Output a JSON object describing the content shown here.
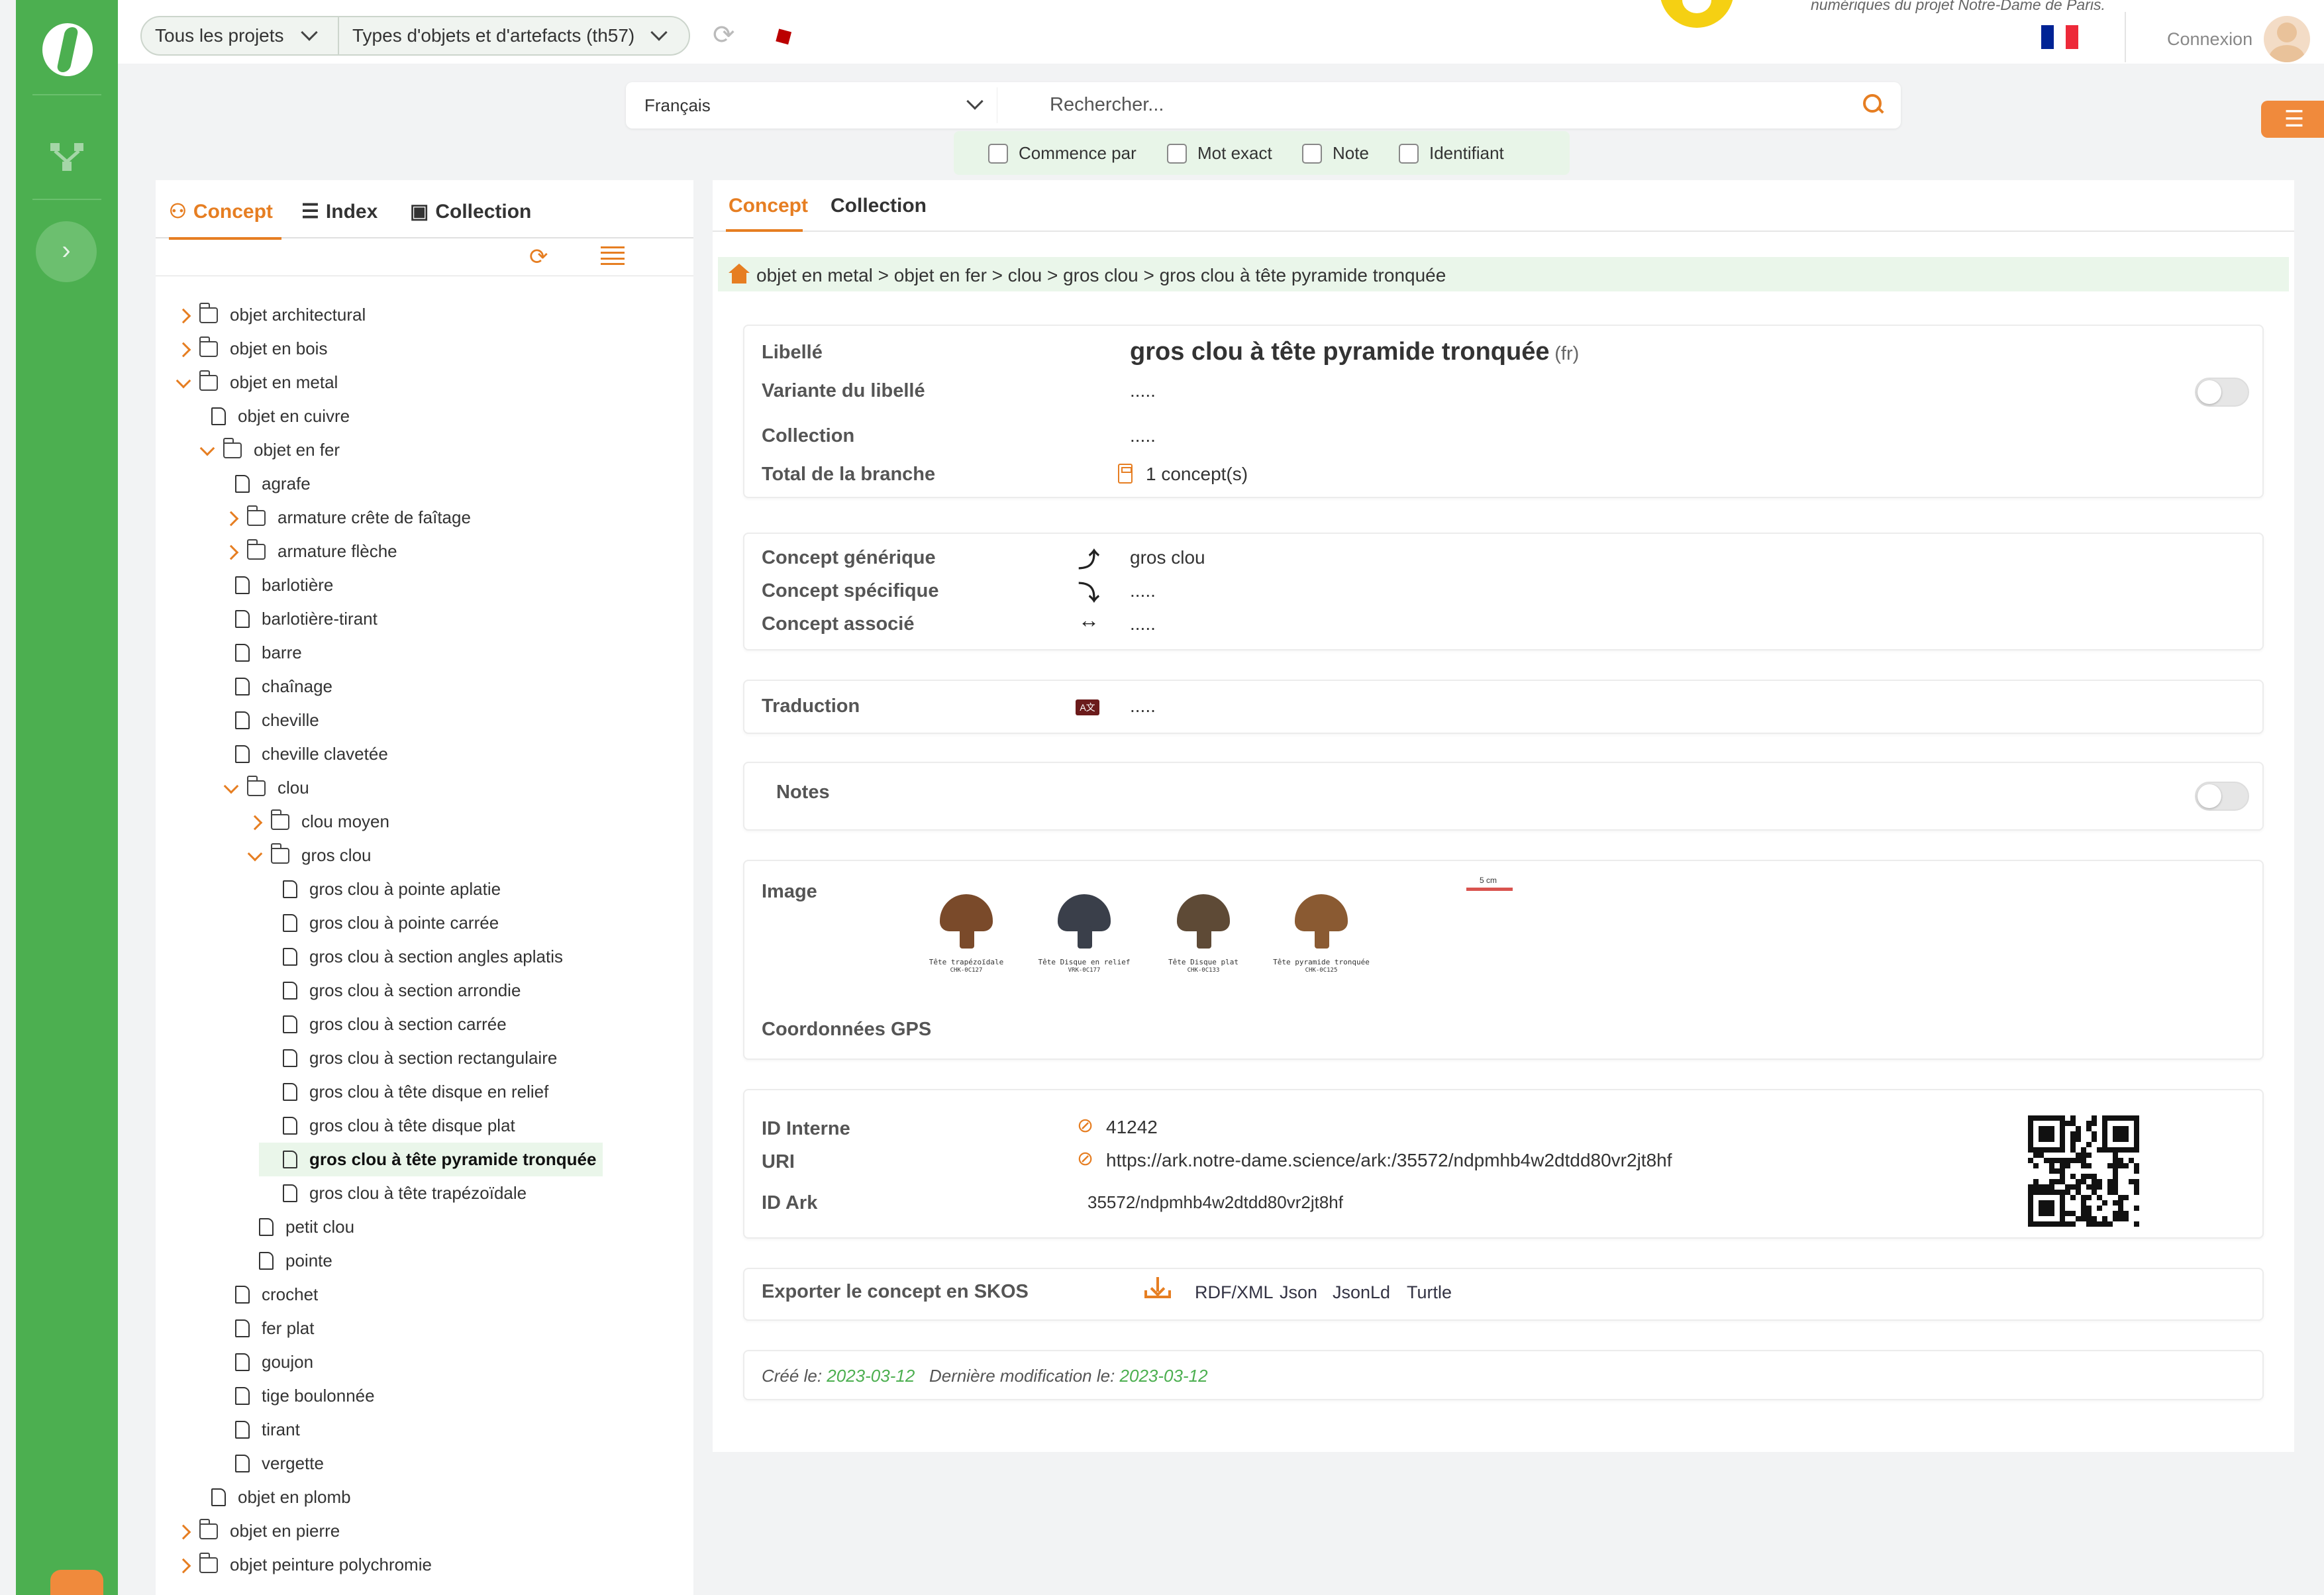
{
  "topbar": {
    "project_select": "Tous les projets",
    "thesaurus_select": "Types d'objets et d'artefacts (th57)",
    "tagline": "numériques du projet Notre-Dame de Paris.",
    "login": "Connexion",
    "flag_colors": [
      "#002395",
      "#ffffff",
      "#ed2939"
    ]
  },
  "search": {
    "language": "Français",
    "placeholder": "Rechercher...",
    "filters": [
      "Commence par",
      "Mot exact",
      "Note",
      "Identifiant"
    ]
  },
  "left_panel": {
    "tabs": [
      "Concept",
      "Index",
      "Collection"
    ],
    "tree": [
      {
        "label": "objet architectural",
        "depth": 0,
        "type": "folder",
        "state": "closed"
      },
      {
        "label": "objet en bois",
        "depth": 0,
        "type": "folder",
        "state": "closed"
      },
      {
        "label": "objet en metal",
        "depth": 0,
        "type": "folder",
        "state": "open"
      },
      {
        "label": "objet en cuivre",
        "depth": 1,
        "type": "file"
      },
      {
        "label": "objet en fer",
        "depth": 1,
        "type": "folder",
        "state": "open"
      },
      {
        "label": "agrafe",
        "depth": 2,
        "type": "file"
      },
      {
        "label": "armature crête de faîtage",
        "depth": 2,
        "type": "folder",
        "state": "closed"
      },
      {
        "label": "armature flèche",
        "depth": 2,
        "type": "folder",
        "state": "closed"
      },
      {
        "label": "barlotière",
        "depth": 2,
        "type": "file"
      },
      {
        "label": "barlotière-tirant",
        "depth": 2,
        "type": "file"
      },
      {
        "label": "barre",
        "depth": 2,
        "type": "file"
      },
      {
        "label": "chaînage",
        "depth": 2,
        "type": "file"
      },
      {
        "label": "cheville",
        "depth": 2,
        "type": "file"
      },
      {
        "label": "cheville clavetée",
        "depth": 2,
        "type": "file"
      },
      {
        "label": "clou",
        "depth": 2,
        "type": "folder",
        "state": "open"
      },
      {
        "label": "clou moyen",
        "depth": 3,
        "type": "folder",
        "state": "closed"
      },
      {
        "label": "gros clou",
        "depth": 3,
        "type": "folder",
        "state": "open"
      },
      {
        "label": "gros clou à pointe aplatie",
        "depth": 4,
        "type": "file"
      },
      {
        "label": "gros clou à pointe carrée",
        "depth": 4,
        "type": "file"
      },
      {
        "label": "gros clou à section angles aplatis",
        "depth": 4,
        "type": "file"
      },
      {
        "label": "gros clou à section arrondie",
        "depth": 4,
        "type": "file"
      },
      {
        "label": "gros clou à section carrée",
        "depth": 4,
        "type": "file"
      },
      {
        "label": "gros clou à section rectangulaire",
        "depth": 4,
        "type": "file"
      },
      {
        "label": "gros clou à tête disque en relief",
        "depth": 4,
        "type": "file"
      },
      {
        "label": "gros clou à tête disque plat",
        "depth": 4,
        "type": "file"
      },
      {
        "label": "gros clou à tête pyramide tronquée",
        "depth": 4,
        "type": "file",
        "selected": true
      },
      {
        "label": "gros clou à tête trapézoïdale",
        "depth": 4,
        "type": "file"
      },
      {
        "label": "petit clou",
        "depth": 3,
        "type": "file"
      },
      {
        "label": "pointe",
        "depth": 3,
        "type": "file"
      },
      {
        "label": "crochet",
        "depth": 2,
        "type": "file"
      },
      {
        "label": "fer plat",
        "depth": 2,
        "type": "file"
      },
      {
        "label": "goujon",
        "depth": 2,
        "type": "file"
      },
      {
        "label": "tige boulonnée",
        "depth": 2,
        "type": "file"
      },
      {
        "label": "tirant",
        "depth": 2,
        "type": "file"
      },
      {
        "label": "vergette",
        "depth": 2,
        "type": "file"
      },
      {
        "label": "objet en plomb",
        "depth": 1,
        "type": "file"
      },
      {
        "label": "objet en pierre",
        "depth": 0,
        "type": "folder",
        "state": "closed"
      },
      {
        "label": "objet peinture polychromie",
        "depth": 0,
        "type": "folder",
        "state": "closed"
      }
    ]
  },
  "right_panel": {
    "tabs": [
      "Concept",
      "Collection"
    ],
    "breadcrumb": "objet en metal > objet en fer > clou > gros clou > gros clou à tête pyramide tronquée",
    "label_card": {
      "libelle_label": "Libellé",
      "libelle_value": "gros clou à tête pyramide tronquée",
      "lang": "(fr)",
      "variante_label": "Variante du libellé",
      "variante_value": ".....",
      "collection_label": "Collection",
      "collection_value": ".....",
      "total_label": "Total de la branche",
      "total_value": "1 concept(s)"
    },
    "relations": {
      "generique_label": "Concept générique",
      "generique_value": "gros clou",
      "specifique_label": "Concept spécifique",
      "specifique_value": ".....",
      "associe_label": "Concept associé",
      "associe_value": "....."
    },
    "traduction": {
      "label": "Traduction",
      "value": "....."
    },
    "notes": {
      "label": "Notes"
    },
    "image": {
      "label": "Image",
      "gps_label": "Coordonnées GPS",
      "thumbnails": [
        {
          "caption": "Tête trapézoïdale",
          "code": "CHK-0C127",
          "color": "#7a4a2a"
        },
        {
          "caption": "Tête Disque en relief",
          "code": "VRK-0C177",
          "color": "#3a3f4a"
        },
        {
          "caption": "Tête Disque plat",
          "code": "CHK-0C133",
          "color": "#5e4a36"
        },
        {
          "caption": "Tête pyramide tronquée",
          "code": "CHK-0C125",
          "color": "#8a5a32"
        }
      ],
      "scale_label": "5 cm"
    },
    "ids": {
      "interne_label": "ID Interne",
      "interne_value": "41242",
      "uri_label": "URI",
      "uri_value": "https://ark.notre-dame.science/ark:/35572/ndpmhb4w2dtdd80vr2jt8hf",
      "ark_label": "ID Ark",
      "ark_value": "35572/ndpmhb4w2dtdd80vr2jt8hf"
    },
    "export": {
      "label": "Exporter le concept en SKOS",
      "formats": [
        "RDF/XML",
        "Json",
        "JsonLd",
        "Turtle"
      ]
    },
    "meta": {
      "created_label": "Créé le:",
      "created_date": "2023-03-12",
      "modified_label": "Dernière modification le:",
      "modified_date": "2023-03-12"
    }
  }
}
